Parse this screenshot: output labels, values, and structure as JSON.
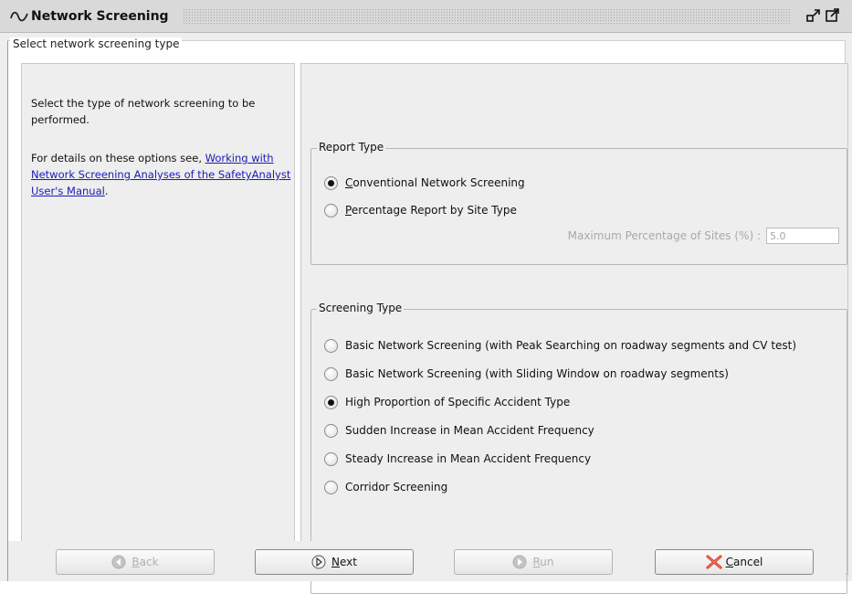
{
  "window": {
    "title": "Network Screening"
  },
  "section": {
    "legend": "Select network screening type"
  },
  "help": {
    "intro": "Select the type of network screening to be performed.",
    "details_prefix": "For details on these options see, ",
    "link_text": "Working with Network Screening Analyses of the SafetyAnalyst User's Manual",
    "details_suffix": "."
  },
  "report_type": {
    "legend": "Report Type",
    "options": [
      {
        "label": "Conventional Network Screening",
        "mnemonic": "C",
        "rest": "onventional Network Screening",
        "selected": true
      },
      {
        "label": "Percentage Report by Site Type",
        "mnemonic": "P",
        "rest": "ercentage Report by Site Type",
        "selected": false
      }
    ],
    "max_pct_label": "Maximum Percentage of Sites (%) :",
    "max_pct_value": "5.0"
  },
  "screening_type": {
    "legend": "Screening Type",
    "options": [
      {
        "label": "Basic Network Screening (with Peak Searching on roadway segments and CV test)",
        "selected": false
      },
      {
        "label": "Basic Network Screening (with Sliding Window on roadway segments)",
        "selected": false
      },
      {
        "label": "High Proportion of Specific Accident Type",
        "selected": true
      },
      {
        "label": "Sudden Increase in Mean Accident Frequency",
        "selected": false
      },
      {
        "label": "Steady Increase in Mean Accident Frequency",
        "selected": false
      },
      {
        "label": "Corridor Screening",
        "selected": false
      }
    ]
  },
  "buttons": {
    "back": {
      "mnemonic": "B",
      "rest": "ack",
      "enabled": false
    },
    "next": {
      "mnemonic": "N",
      "rest": "ext",
      "enabled": true
    },
    "run": {
      "mnemonic": "R",
      "rest": "un",
      "enabled": false
    },
    "cancel": {
      "mnemonic": "C",
      "rest": "ancel",
      "enabled": true
    }
  },
  "icons": {
    "title": "wave-icon",
    "restore": "restore-window-icon",
    "maximize": "maximize-window-icon",
    "back": "back-arrow-icon",
    "next": "next-arrow-icon",
    "run": "run-icon",
    "cancel": "red-x-icon"
  },
  "colors": {
    "link": "#1a1ab8",
    "cancel_icon": "#d63a2a",
    "disabled_text": "#b0b0b0"
  }
}
